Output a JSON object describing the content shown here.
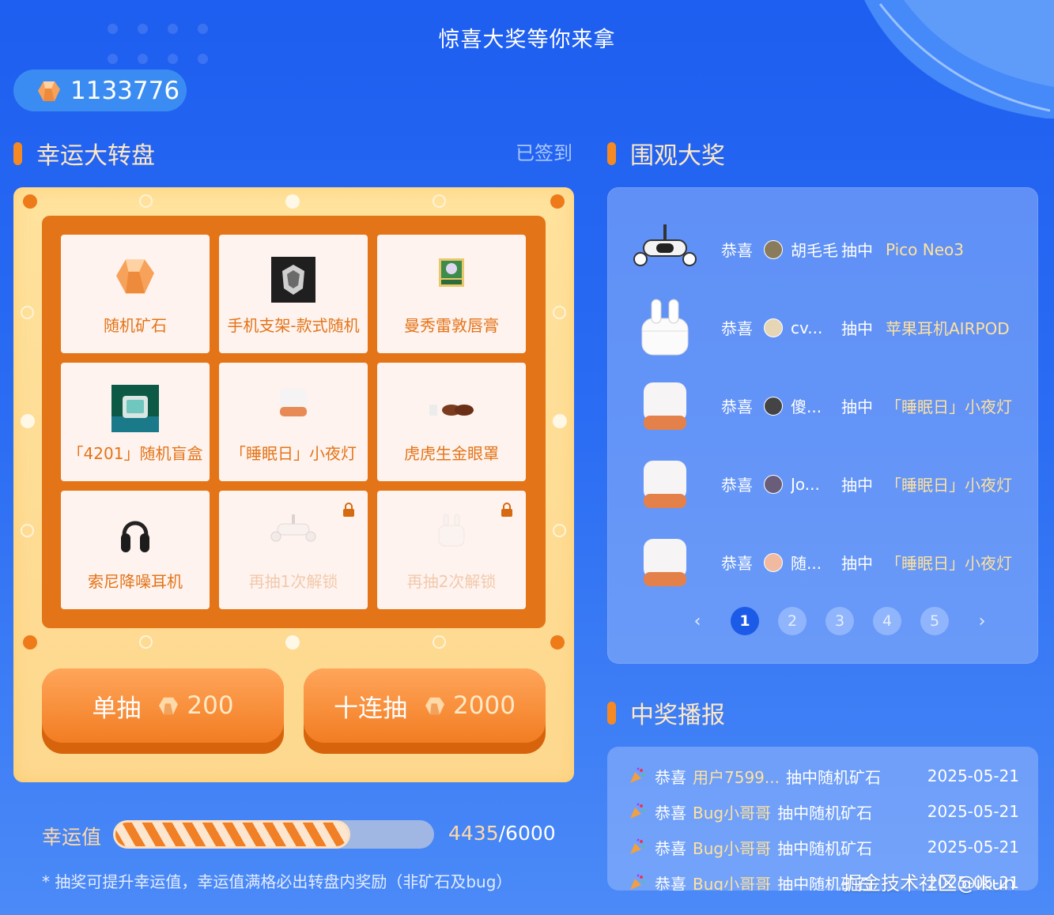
{
  "header": {
    "title": "惊喜大奖等你来拿"
  },
  "balance": {
    "value": "1133776",
    "icon": "ore-gem-icon"
  },
  "sections": {
    "wheel": "幸运大转盘",
    "signed": "已签到",
    "watch": "围观大奖",
    "broadcast": "中奖播报"
  },
  "grid": [
    {
      "label": "随机矿石",
      "icon": "ore-gem-icon",
      "locked": false
    },
    {
      "label": "手机支架-款式随机",
      "icon": "phone-holder-image",
      "locked": false
    },
    {
      "label": "曼秀雷敦唇膏",
      "icon": "lip-balm-image",
      "locked": false
    },
    {
      "label": "「4201」随机盲盒",
      "icon": "blind-box-image",
      "locked": false
    },
    {
      "label": "「睡眠日」小夜灯",
      "icon": "night-light-image",
      "locked": false
    },
    {
      "label": "虎虎生金眼罩",
      "icon": "eye-mask-image",
      "locked": false
    },
    {
      "label": "索尼降噪耳机",
      "icon": "headphones-image",
      "locked": false
    },
    {
      "label": "再抽1次解锁",
      "icon": "vr-headset-image",
      "locked": true
    },
    {
      "label": "再抽2次解锁",
      "icon": "earbuds-image",
      "locked": true
    }
  ],
  "buttons": {
    "single": {
      "label": "单抽",
      "cost": "200"
    },
    "ten": {
      "label": "十连抽",
      "cost": "2000"
    }
  },
  "luck": {
    "label": "幸运值",
    "current": "4435",
    "total": "/6000",
    "fraction": 0.739
  },
  "note": "* 抽奖可提升幸运值，幸运值满格必出转盘内奖励（非矿石及bug）",
  "winners": [
    {
      "congrats": "恭喜",
      "user": "胡毛毛",
      "verb": "抽中",
      "prize": "Pico Neo3",
      "product": "vr-headset-image"
    },
    {
      "congrats": "恭喜",
      "user": "cv...",
      "verb": "抽中",
      "prize": "苹果耳机AIRPOD",
      "product": "earbuds-image"
    },
    {
      "congrats": "恭喜",
      "user": "傻...",
      "verb": "抽中",
      "prize": "「睡眠日」小夜灯",
      "product": "night-light-image"
    },
    {
      "congrats": "恭喜",
      "user": "Jo...",
      "verb": "抽中",
      "prize": "「睡眠日」小夜灯",
      "product": "night-light-image"
    },
    {
      "congrats": "恭喜",
      "user": "随...",
      "verb": "抽中",
      "prize": "「睡眠日」小夜灯",
      "product": "night-light-image"
    }
  ],
  "pager": {
    "prev": "‹",
    "next": "›",
    "pages": [
      "1",
      "2",
      "3",
      "4",
      "5"
    ],
    "active": "1"
  },
  "broadcast": [
    {
      "c": "恭喜",
      "u": "用户7599...",
      "msg": "抽中随机矿石",
      "date": "2025-05-21"
    },
    {
      "c": "恭喜",
      "u": "Bug小哥哥",
      "msg": "抽中随机矿石",
      "date": "2025-05-21"
    },
    {
      "c": "恭喜",
      "u": "Bug小哥哥",
      "msg": "抽中随机矿石",
      "date": "2025-05-21"
    },
    {
      "c": "恭喜",
      "u": "Bug小哥哥",
      "msg": "抽中随机矿石",
      "date": "2025-05-21"
    }
  ],
  "watermark": "掘金技术社区@ikun",
  "colors": {
    "accent": "#f27d22",
    "bg": "#2a6cf3",
    "prize": "#ffe29d",
    "frame": "#e37418"
  }
}
